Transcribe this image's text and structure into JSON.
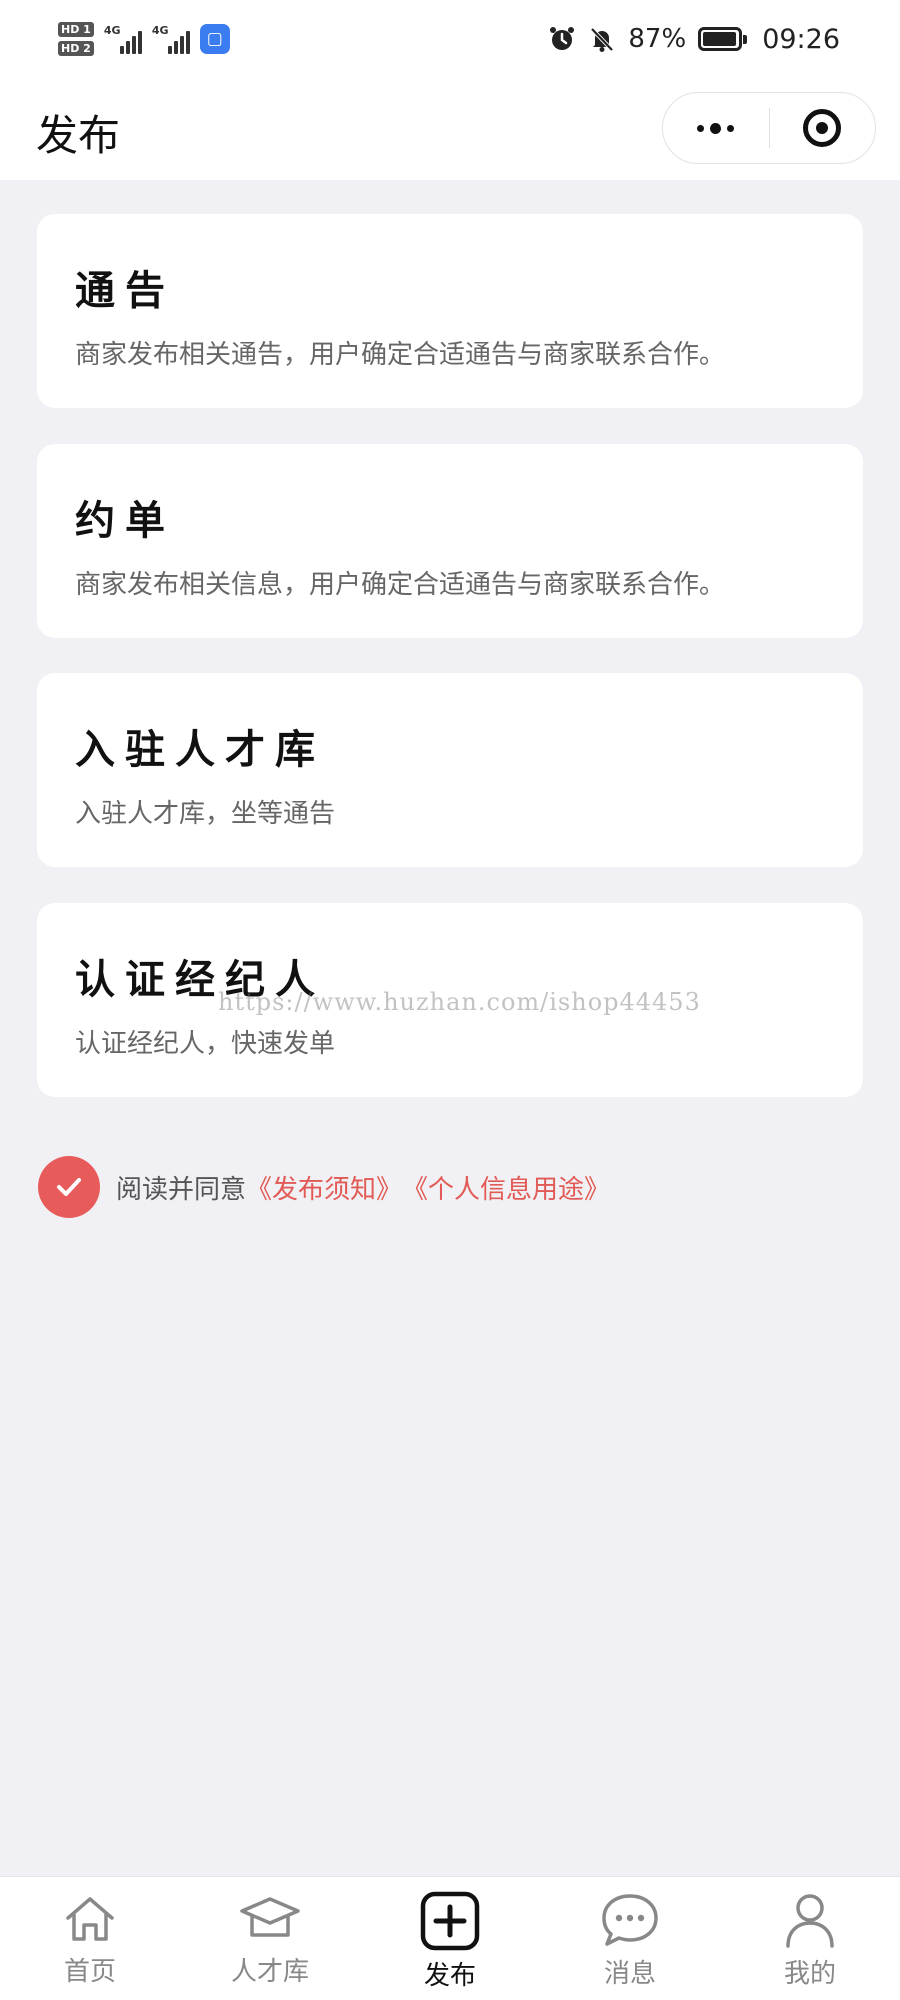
{
  "status_bar": {
    "sim1": "HD 1",
    "sim2": "HD 2",
    "network1": "4G",
    "network2": "4G",
    "battery_percent": "87%",
    "battery_level": 0.87,
    "time": "09:26",
    "icons": [
      "alarm-icon",
      "mute-bell-icon",
      "battery-icon"
    ]
  },
  "nav": {
    "title": "发布",
    "more_icon": "more-dots-icon",
    "close_icon": "target-icon"
  },
  "cards": [
    {
      "title": "通告",
      "desc": "商家发布相关通告，用户确定合适通告与商家联系合作。"
    },
    {
      "title": "约单",
      "desc": "商家发布相关信息，用户确定合适通告与商家联系合作。"
    },
    {
      "title": "入驻人才库",
      "desc": "入驻人才库，坐等通告"
    },
    {
      "title": "认证经纪人",
      "desc": "认证经纪人，快速发单"
    }
  ],
  "agreement": {
    "checked": true,
    "text": "阅读并同意",
    "link1": "《发布须知》",
    "link2": "《个人信息用途》",
    "accent_color": "#e25a55"
  },
  "watermark": "https://www.huzhan.com/ishop44453",
  "tabs": [
    {
      "label": "首页",
      "icon": "home-icon",
      "active": false
    },
    {
      "label": "人才库",
      "icon": "graduation-cap-icon",
      "active": false
    },
    {
      "label": "发布",
      "icon": "plus-square-icon",
      "active": true
    },
    {
      "label": "消息",
      "icon": "chat-bubble-icon",
      "active": false
    },
    {
      "label": "我的",
      "icon": "person-icon",
      "active": false
    }
  ]
}
